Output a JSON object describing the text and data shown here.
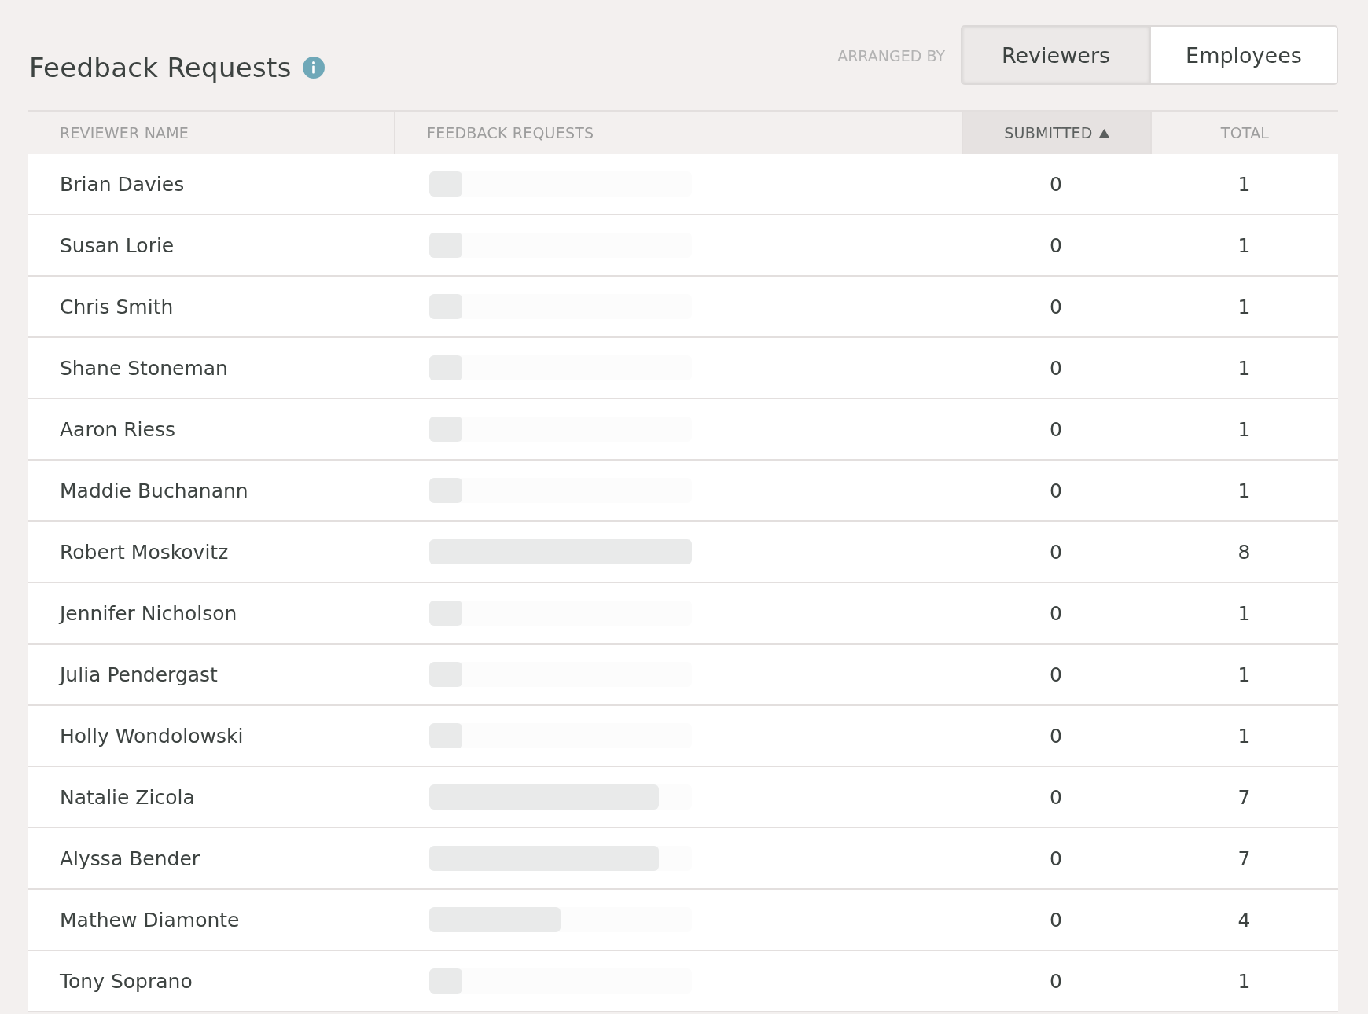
{
  "title": "Feedback Requests",
  "arranged_by": {
    "label": "ARRANGED BY",
    "options": [
      {
        "label": "Reviewers",
        "selected": true
      },
      {
        "label": "Employees",
        "selected": false
      }
    ]
  },
  "table": {
    "columns": [
      {
        "label": "REVIEWER NAME",
        "sorted": false
      },
      {
        "label": "FEEDBACK REQUESTS",
        "sorted": false
      },
      {
        "label": "SUBMITTED",
        "sorted": true
      },
      {
        "label": "TOTAL",
        "sorted": false
      }
    ],
    "rows": [
      {
        "name": "Brian Davies",
        "level": 0.125,
        "submitted": "0",
        "total": "1"
      },
      {
        "name": "Susan Lorie",
        "level": 0.125,
        "submitted": "0",
        "total": "1"
      },
      {
        "name": "Chris Smith",
        "level": 0.125,
        "submitted": "0",
        "total": "1"
      },
      {
        "name": "Shane Stoneman",
        "level": 0.125,
        "submitted": "0",
        "total": "1"
      },
      {
        "name": "Aaron Riess",
        "level": 0.125,
        "submitted": "0",
        "total": "1"
      },
      {
        "name": "Maddie Buchanann",
        "level": 0.125,
        "submitted": "0",
        "total": "1"
      },
      {
        "name": "Robert Moskovitz",
        "level": 1,
        "submitted": "0",
        "total": "8"
      },
      {
        "name": "Jennifer Nicholson",
        "level": 0.125,
        "submitted": "0",
        "total": "1"
      },
      {
        "name": "Julia Pendergast",
        "level": 0.125,
        "submitted": "0",
        "total": "1"
      },
      {
        "name": "Holly Wondolowski",
        "level": 0.125,
        "submitted": "0",
        "total": "1"
      },
      {
        "name": "Natalie Zicola",
        "level": 0.875,
        "submitted": "0",
        "total": "7"
      },
      {
        "name": "Alyssa Bender",
        "level": 0.875,
        "submitted": "0",
        "total": "7"
      },
      {
        "name": "Mathew Diamonte",
        "level": 0.5,
        "submitted": "0",
        "total": "4"
      },
      {
        "name": "Tony Soprano",
        "level": 0.125,
        "submitted": "0",
        "total": "1"
      }
    ]
  }
}
